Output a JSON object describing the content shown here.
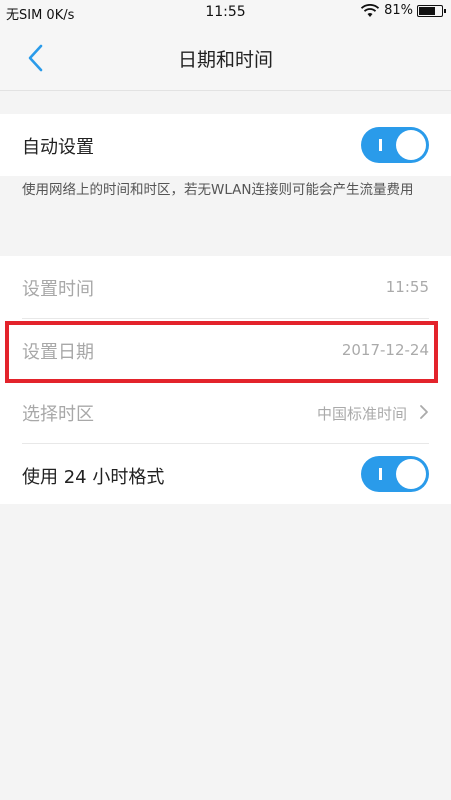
{
  "status": {
    "carrier": "无SIM 0K/s",
    "time": "11:55",
    "battery": "81%",
    "battery_level": 0.81
  },
  "nav": {
    "title": "日期和时间"
  },
  "auto_setting": {
    "label": "自动设置",
    "enabled": true,
    "hint": "使用网络上的时间和时区，若无WLAN连接则可能会产生流量费用"
  },
  "rows": [
    {
      "label": "设置时间",
      "value": "11:55"
    },
    {
      "label": "设置日期",
      "value": "2017-12-24"
    },
    {
      "label": "选择时区",
      "value": "中国标准时间"
    }
  ],
  "format24": {
    "label": "使用 24 小时格式",
    "enabled": true
  },
  "colors": {
    "accent": "#2a9bea",
    "highlight": "#e3232b"
  }
}
